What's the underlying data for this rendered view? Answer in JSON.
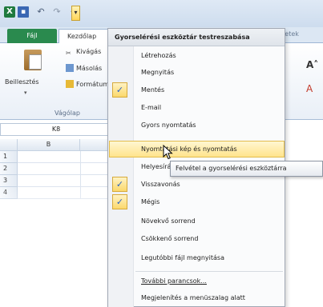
{
  "app": {
    "qat": {
      "undo_glyph": "↶",
      "redo_glyph": "↷",
      "dropdown_glyph": "▾"
    },
    "tabs": {
      "file": "Fájl",
      "home": "Kezdőlap",
      "partial_right": "pletek"
    },
    "ribbon": {
      "paste_label": "Beillesztés",
      "cut_label": "Kivágás",
      "copy_label": "Másolás",
      "format_label": "Formátum",
      "group_label": "Vágólap",
      "font_grow": "A˄",
      "font_color": "A"
    },
    "name_box": "K8",
    "grid": {
      "column_header": "B",
      "rows": [
        "1",
        "2",
        "3",
        "4"
      ]
    }
  },
  "menu": {
    "title": "Gyorselérési eszköztár testreszabása",
    "items": [
      {
        "label": "Létrehozás",
        "checked": false
      },
      {
        "label": "Megnyitás",
        "checked": false
      },
      {
        "label": "Mentés",
        "checked": true
      },
      {
        "label": "E-mail",
        "checked": false
      },
      {
        "label": "Gyors nyomtatás",
        "checked": false
      },
      {
        "label": "Nyomtatási kép és nyomtatás",
        "checked": false,
        "highlighted": true
      },
      {
        "label": "Helyesírás",
        "checked": false
      },
      {
        "label": "Visszavonás",
        "checked": true
      },
      {
        "label": "Mégis",
        "checked": true
      },
      {
        "label": "Növekvő sorrend",
        "checked": false
      },
      {
        "label": "Csökkenő sorrend",
        "checked": false
      },
      {
        "label": "Legutóbbi fájl megnyitása",
        "checked": false
      }
    ],
    "more_commands": "További parancsok...",
    "show_below": "Megjelenítés a menüszalag alatt",
    "check_glyph": "✓"
  },
  "tooltip": "Felvétel a gyorselérési eszköztárra",
  "colors": {
    "highlight": "#ffe48c",
    "file_tab": "#2a8a4e",
    "check_mark": "#2a62c4"
  }
}
